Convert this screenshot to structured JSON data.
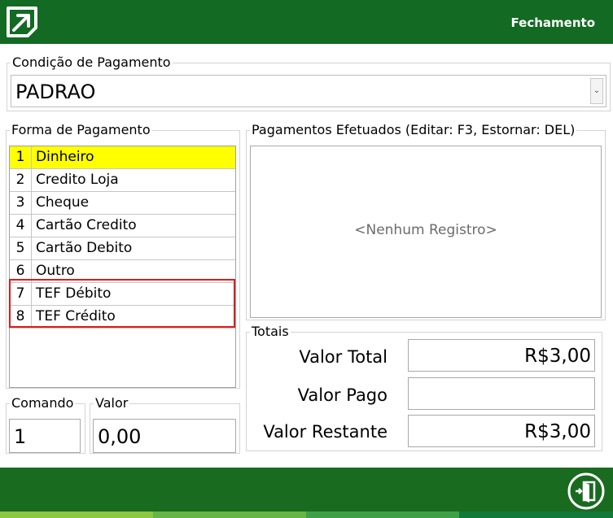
{
  "header": {
    "title": "Fechamento",
    "logo_icon": "arrow-logo-icon",
    "background": "#136a22"
  },
  "condicao": {
    "label": "Condição de Pagamento",
    "value": "PADRAO",
    "dropdown_icon": "chevron-down-icon"
  },
  "forma": {
    "label": "Forma de Pagamento",
    "selected_color": "#ffff00",
    "highlight_color": "#e01b1b",
    "items": [
      {
        "num": "1",
        "label": "Dinheiro"
      },
      {
        "num": "2",
        "label": "Credito Loja"
      },
      {
        "num": "3",
        "label": "Cheque"
      },
      {
        "num": "4",
        "label": "Cartão Credito"
      },
      {
        "num": "5",
        "label": "Cartão Debito"
      },
      {
        "num": "6",
        "label": "Outro"
      },
      {
        "num": "7",
        "label": "TEF Débito"
      },
      {
        "num": "8",
        "label": "TEF Crédito"
      }
    ]
  },
  "pagamentos": {
    "label": "Pagamentos Efetuados (Editar: F3, Estornar: DEL)",
    "empty_text": "<Nenhum Registro>"
  },
  "totais": {
    "label": "Totais",
    "valor_total_label": "Valor Total",
    "valor_total": "R$3,00",
    "valor_pago_label": "Valor Pago",
    "valor_pago": "",
    "valor_restante_label": "Valor Restante",
    "valor_restante": "R$3,00"
  },
  "comando": {
    "label": "Comando",
    "value": "1"
  },
  "valor": {
    "label": "Valor",
    "value": "0,00"
  },
  "footer": {
    "exit_icon": "exit-door-icon",
    "background": "#196b1f",
    "stripe_colors": [
      "#8dc63f",
      "#66b545",
      "#3fa048",
      "#117a3a"
    ]
  }
}
